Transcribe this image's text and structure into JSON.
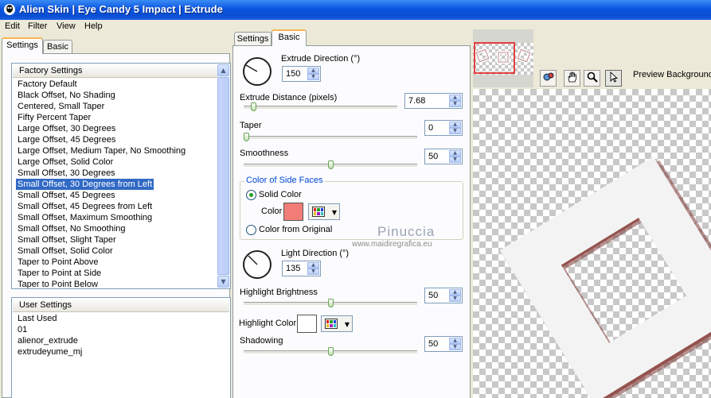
{
  "window": {
    "title": "Alien Skin | Eye Candy 5 Impact | Extrude"
  },
  "menu": [
    "Edit",
    "Filter",
    "View",
    "Help"
  ],
  "left_tabs": [
    "Settings",
    "Basic"
  ],
  "factory": {
    "header": "Factory Settings",
    "items": [
      "Factory Default",
      "Black Offset, No Shading",
      "Centered, Small Taper",
      "Fifty Percent Taper",
      "Large Offset, 30 Degrees",
      "Large Offset, 45 Degrees",
      "Large Offset, Medium Taper, No Smoothing",
      "Large Offset, Solid Color",
      "Small Offset, 30 Degrees",
      "Small Offset, 30 Degrees from Left",
      "Small Offset, 45 Degrees",
      "Small Offset, 45 Degrees from Left",
      "Small Offset, Maximum Smoothing",
      "Small Offset, No Smoothing",
      "Small Offset, Slight Taper",
      "Small Offset, Solid Color",
      "Taper to Point Above",
      "Taper to Point at Side",
      "Taper to Point Below"
    ],
    "selected_index": 9
  },
  "user": {
    "header": "User Settings",
    "items": [
      "Last Used",
      "01",
      "alienor_extrude",
      "extrudeyume_mj"
    ]
  },
  "mid_tabs": [
    "Settings",
    "Basic"
  ],
  "basic": {
    "extrude_direction": {
      "label": "Extrude Direction (°)",
      "value": "150"
    },
    "extrude_distance": {
      "label": "Extrude Distance (pixels)",
      "value": "7.68",
      "slider": 0.05
    },
    "taper": {
      "label": "Taper",
      "value": "0",
      "slider": 0.0
    },
    "smoothness": {
      "label": "Smoothness",
      "value": "50",
      "slider": 0.5
    },
    "side_faces": {
      "title": "Color of Side Faces",
      "solid_label": "Solid Color",
      "color_label": "Color",
      "color": "#f27d76",
      "original_label": "Color from Original",
      "selected": "solid"
    },
    "light_direction": {
      "label": "Light Direction (°)",
      "value": "135"
    },
    "highlight_brightness": {
      "label": "Highlight Brightness",
      "value": "50",
      "slider": 0.5
    },
    "highlight_color": {
      "label": "Highlight Color",
      "color": "#ffffff"
    },
    "shadowing": {
      "label": "Shadowing",
      "value": "50",
      "slider": 0.5
    }
  },
  "preview": {
    "background_label": "Preview Background"
  },
  "watermark": {
    "name": "Pinuccia",
    "url": "www.maidiregrafica.eu"
  },
  "colors": {
    "accent": "#316ac5",
    "titlebar": "#0a4ed3",
    "tab_highlight": "#f7b64d"
  }
}
